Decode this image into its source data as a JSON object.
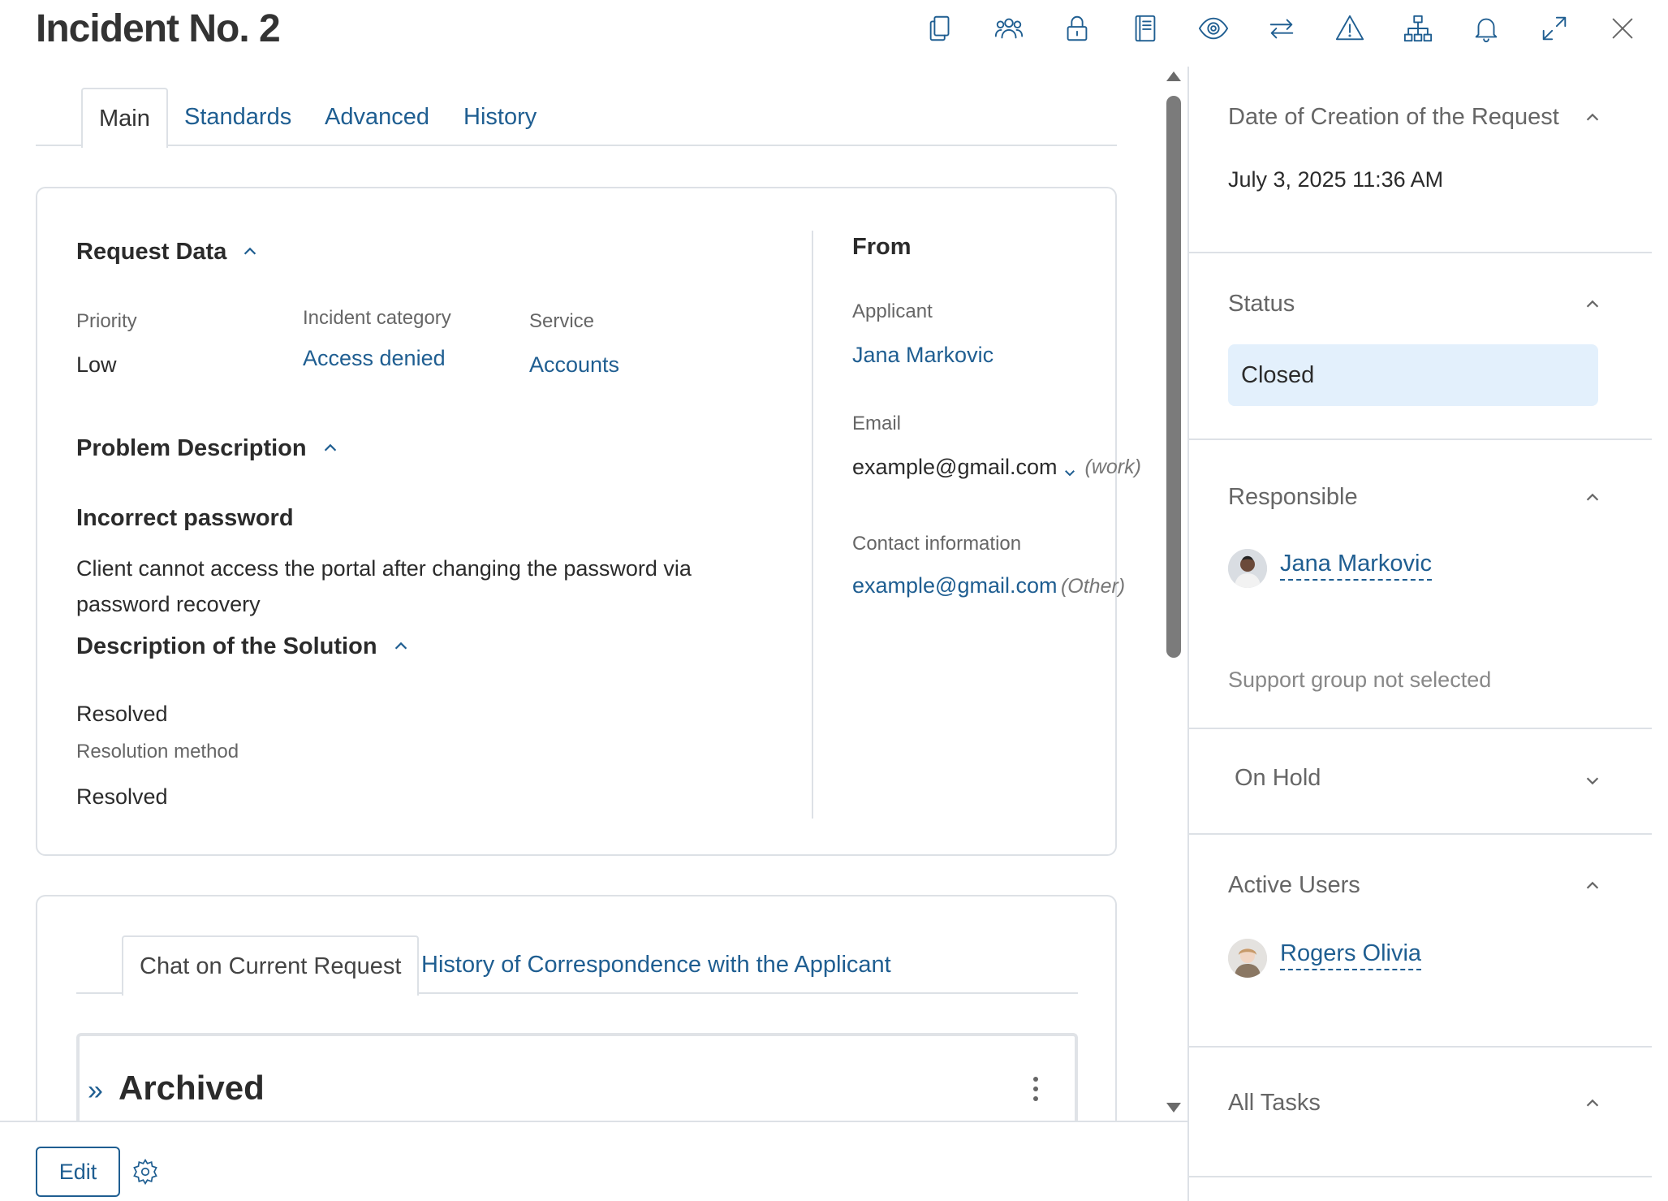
{
  "window": {
    "title": "Incident No. 2"
  },
  "toolbar": {
    "icons": [
      "copy-icon",
      "users-icon",
      "lock-icon",
      "book-icon",
      "eye-icon",
      "swap-icon",
      "warning-icon",
      "hierarchy-icon",
      "bell-icon",
      "expand-icon",
      "close-icon"
    ]
  },
  "tabs": [
    {
      "label": "Main",
      "active": true
    },
    {
      "label": "Standards"
    },
    {
      "label": "Advanced"
    },
    {
      "label": "History"
    }
  ],
  "request_data": {
    "heading": "Request Data",
    "priority_label": "Priority",
    "priority_value": "Low",
    "category_label": "Incident category",
    "category_value": "Access denied",
    "service_label": "Service",
    "service_value": "Accounts"
  },
  "problem": {
    "heading": "Problem Description",
    "title": "Incorrect password",
    "text": "Client cannot access the portal after changing the password via password recovery"
  },
  "solution": {
    "heading": "Description of the Solution",
    "value": "Resolved",
    "method_label": "Resolution method",
    "method_value": "Resolved"
  },
  "from": {
    "heading": "From",
    "applicant_label": "Applicant",
    "applicant_value": "Jana Markovic",
    "email_label": "Email",
    "email_value": "example@gmail.com",
    "email_type": "(work)",
    "contact_label": "Contact information",
    "contact_value": "example@gmail.com",
    "contact_type": "(Other)"
  },
  "chat": {
    "tab_current": "Chat on Current Request",
    "tab_history": "History of Correspondence with the Applicant",
    "archived_title": "Archived",
    "archived_arrow": "»"
  },
  "bottom": {
    "edit_label": "Edit"
  },
  "right_panel": {
    "creation": {
      "heading": "Date of Creation of the Request",
      "value": "July 3, 2025 11:36 AM"
    },
    "status": {
      "heading": "Status",
      "value": "Closed"
    },
    "responsible": {
      "heading": "Responsible",
      "user": "Jana Markovic",
      "group_note": "Support group not selected"
    },
    "on_hold": {
      "heading": "On Hold"
    },
    "active_users": {
      "heading": "Active Users",
      "user": "Rogers Olivia"
    },
    "all_tasks": {
      "heading": "All Tasks"
    }
  },
  "colors": {
    "accent": "#1f5e91",
    "status_bg": "#e3f0fc",
    "border": "#dde1e6"
  }
}
